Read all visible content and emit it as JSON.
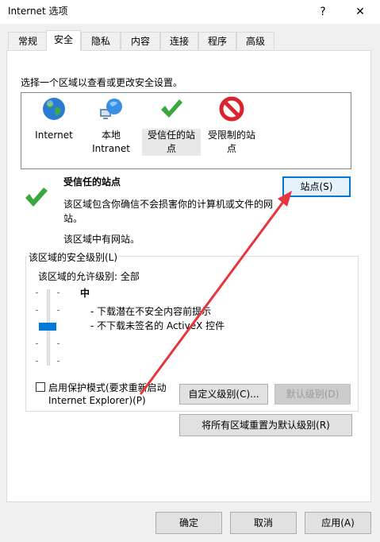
{
  "window": {
    "title": "Internet 选项",
    "help_label": "?",
    "close_label": "✕"
  },
  "tabs": [
    {
      "label": "常规"
    },
    {
      "label": "安全"
    },
    {
      "label": "隐私"
    },
    {
      "label": "内容"
    },
    {
      "label": "连接"
    },
    {
      "label": "程序"
    },
    {
      "label": "高级"
    }
  ],
  "security": {
    "select_zone_prompt": "选择一个区域以查看或更改安全设置。",
    "zones": [
      {
        "label": "Internet",
        "icon": "globe-icon"
      },
      {
        "label": "本地\nIntranet",
        "icon": "intranet-globe-icon"
      },
      {
        "label": "受信任的站\n点",
        "icon": "green-check-icon"
      },
      {
        "label": "受限制的站\n点",
        "icon": "restricted-icon"
      }
    ],
    "selected_zone_title": "受信任的站点",
    "zone_description": "该区域包含你确信不会损害你的计算机或文件的网站。",
    "zone_has_sites": "该区域中有网站。",
    "sites_button": "站点(S)",
    "level_group_label": "该区域的安全级别(L)",
    "allowed_levels": "该区域的允许级别: 全部",
    "level_name": "中",
    "level_points": [
      "- 下载潜在不安全内容前提示",
      "- 不下载未签名的 ActiveX 控件"
    ],
    "protected_mode_line1": "启用保护模式(要求重新启动",
    "protected_mode_line2": "Internet Explorer)(P)",
    "protected_mode_checked": false,
    "custom_level_button": "自定义级别(C)...",
    "default_level_button": "默认级别(D)",
    "reset_all_button": "将所有区域重置为默认级别(R)"
  },
  "footer": {
    "ok_button": "确定",
    "cancel_button": "取消",
    "apply_button": "应用(A)"
  },
  "colors": {
    "accent": "#0078d7",
    "annotation_arrow": "#e8343b"
  }
}
